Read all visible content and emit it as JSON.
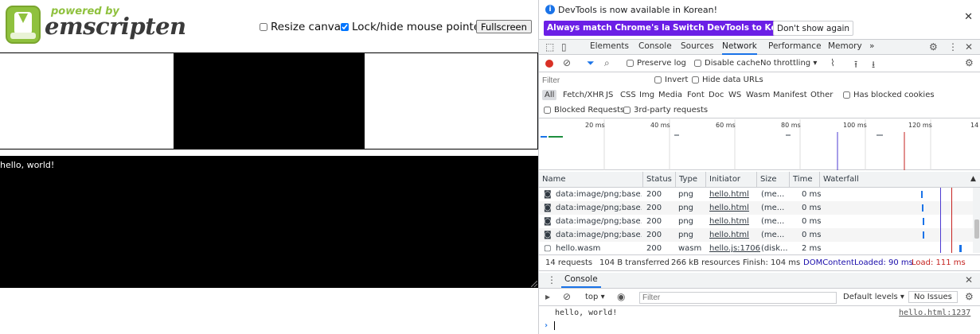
{
  "app": {
    "powered_by": "powered by",
    "brand": "emscripten",
    "resize_label": "Resize canvas",
    "lock_label": "Lock/hide mouse pointer",
    "fullscreen_label": "Fullscreen",
    "output_text": "hello, world!"
  },
  "devtools": {
    "info_message": "DevTools is now available in Korean!",
    "btn_match": "Always match Chrome's language",
    "btn_switch": "Switch DevTools to Korean",
    "btn_dont": "Don't show again",
    "tabs": [
      "Elements",
      "Console",
      "Sources",
      "Network",
      "Performance",
      "Memory"
    ],
    "more": "»",
    "network_toolbar": {
      "preserve_log": "Preserve log",
      "disable_cache": "Disable cache",
      "throttling": "No throttling"
    },
    "filter_placeholder": "Filter",
    "invert": "Invert",
    "hide_data_urls": "Hide data URLs",
    "types": [
      "All",
      "Fetch/XHR",
      "JS",
      "CSS",
      "Img",
      "Media",
      "Font",
      "Doc",
      "WS",
      "Wasm",
      "Manifest",
      "Other"
    ],
    "has_blocked_cookies": "Has blocked cookies",
    "blocked_requests": "Blocked Requests",
    "third_party": "3rd-party requests",
    "timeline_ticks": [
      "20 ms",
      "40 ms",
      "60 ms",
      "80 ms",
      "100 ms",
      "120 ms",
      "14"
    ],
    "columns": [
      "Name",
      "Status",
      "Type",
      "Initiator",
      "Size",
      "Time",
      "Waterfall"
    ],
    "rows": [
      {
        "name": "data:image/png;base...",
        "status": "200",
        "type": "png",
        "initiator": "hello.html",
        "size": "(me...",
        "time": "0 ms"
      },
      {
        "name": "data:image/png;base...",
        "status": "200",
        "type": "png",
        "initiator": "hello.html",
        "size": "(me...",
        "time": "0 ms"
      },
      {
        "name": "data:image/png;base...",
        "status": "200",
        "type": "png",
        "initiator": "hello.html",
        "size": "(me...",
        "time": "0 ms"
      },
      {
        "name": "data:image/png;base...",
        "status": "200",
        "type": "png",
        "initiator": "hello.html",
        "size": "(me...",
        "time": "0 ms"
      },
      {
        "name": "hello.wasm",
        "status": "200",
        "type": "wasm",
        "initiator": "hello.js:1706",
        "size": "(disk...",
        "time": "2 ms"
      }
    ],
    "summary": {
      "requests": "14 requests",
      "transferred": "104 B transferred",
      "resources": "266 kB resources",
      "finish": "Finish: 104 ms",
      "dom": "DOMContentLoaded: 90 ms",
      "load": "Load: 111 ms"
    },
    "drawer_tab": "Console",
    "console_toolbar": {
      "context": "top",
      "filter_placeholder": "Filter",
      "levels": "Default levels",
      "issues": "No Issues"
    },
    "console_message": "hello, world!",
    "console_source": "hello.html:1237"
  }
}
